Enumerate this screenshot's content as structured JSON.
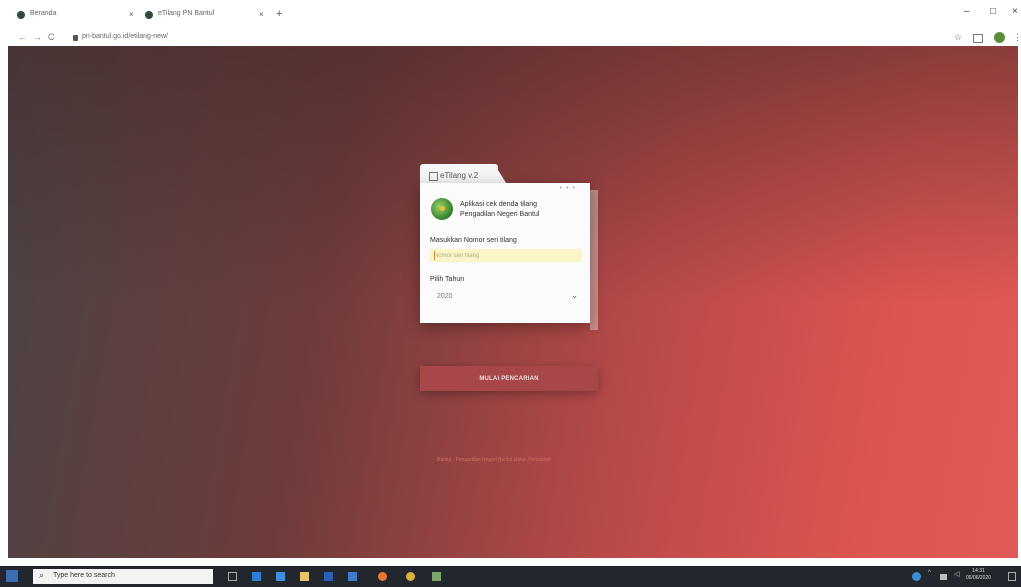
{
  "browser": {
    "tabs": [
      {
        "title": "Beranda",
        "close": "×"
      },
      {
        "title": "eTilang PN Bantul",
        "close": "×"
      }
    ],
    "new_tab": "+",
    "window_controls": {
      "minimize": "–",
      "maximize": "□",
      "close": "×"
    },
    "nav": {
      "back": "←",
      "forward": "→",
      "reload": "C"
    },
    "url": "pn-bantul.go.id/etilang-new/",
    "star": "☆",
    "menu": "⋮"
  },
  "app": {
    "tab_title": "eTilang v.2",
    "menu_dots": "• • •",
    "description_line1": "Aplikasi cek denda tilang",
    "description_line2": "Pengadilan Negeri Bantul",
    "input_label": "Masukkan Nomor seri tilang",
    "input_placeholder": "Nomor seri tilang",
    "year_label": "Pilih Tahun",
    "year_value": "2020",
    "chevron": "⌄",
    "search_button": "MULAI PENCARIAN",
    "footer_text": "Bantul - Pengadilan Negeri Bantul",
    "footer_link": "Untuk Pencarian"
  },
  "taskbar": {
    "search_placeholder": "Type here to search",
    "time": "14:31",
    "date": "06/06/2020"
  },
  "colors": {
    "accent_button": "#a7474a",
    "input_bg": "#fbf6c8",
    "taskbar": "#22272e"
  }
}
